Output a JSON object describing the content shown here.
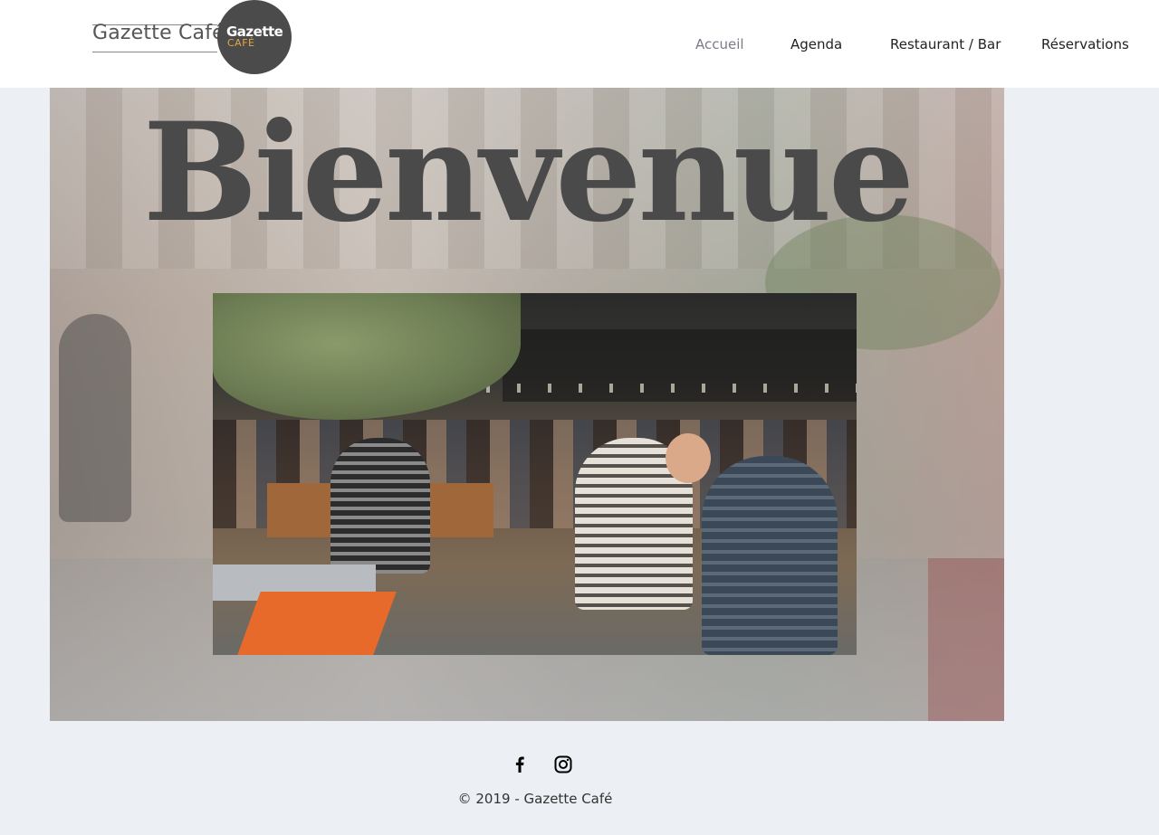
{
  "logo": {
    "text": "Gazette Café",
    "badge_title": "Gazette",
    "badge_sub": "CAFÉ"
  },
  "nav": {
    "items": [
      {
        "label": "Accueil",
        "active": true
      },
      {
        "label": "Agenda",
        "active": false
      },
      {
        "label": "Restaurant / Bar",
        "active": false
      },
      {
        "label": "Réservations",
        "active": false
      }
    ],
    "active_color": "#7a7a8a"
  },
  "hero": {
    "title": "Bienvenue"
  },
  "footer": {
    "social": [
      {
        "icon": "facebook-icon"
      },
      {
        "icon": "instagram-icon"
      }
    ],
    "copyright": "© 2019 - Gazette Café"
  },
  "colors": {
    "page_background": "#eceff3",
    "header_background": "#ffffff",
    "logo_badge": "#4b4b4b",
    "logo_badge_accent": "#e6a640",
    "title_text": "#4a4a4a"
  }
}
